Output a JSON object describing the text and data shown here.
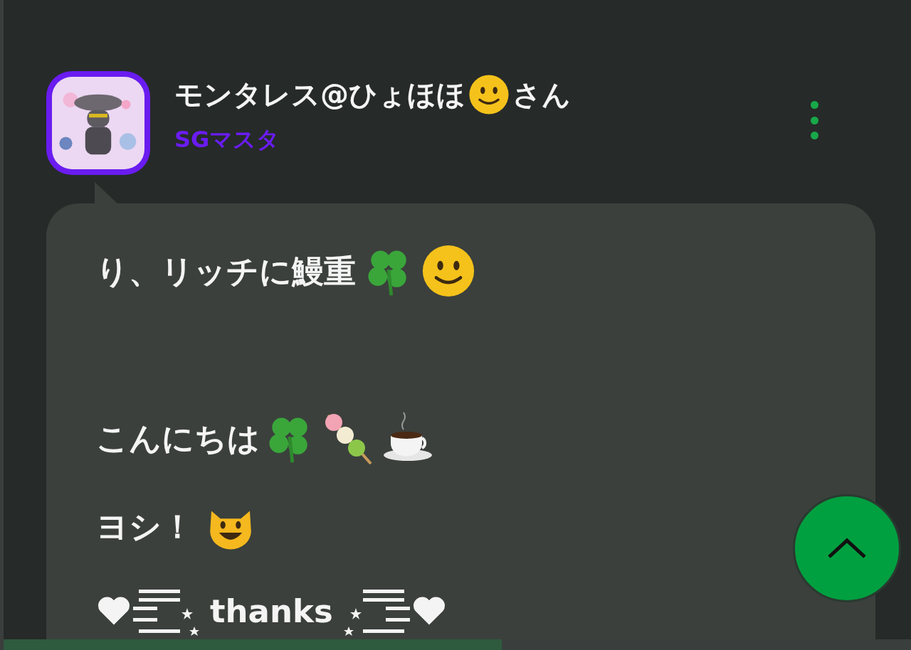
{
  "post": {
    "author": {
      "name": "モンタレス@ひょほほ",
      "suffix": "さん",
      "role": "SGマスタ"
    },
    "lines": [
      {
        "text": "り、リッチに鰻重"
      },
      {
        "text": "こんにちは"
      },
      {
        "text": "ヨシ！"
      },
      {
        "text": "thanks"
      }
    ]
  }
}
